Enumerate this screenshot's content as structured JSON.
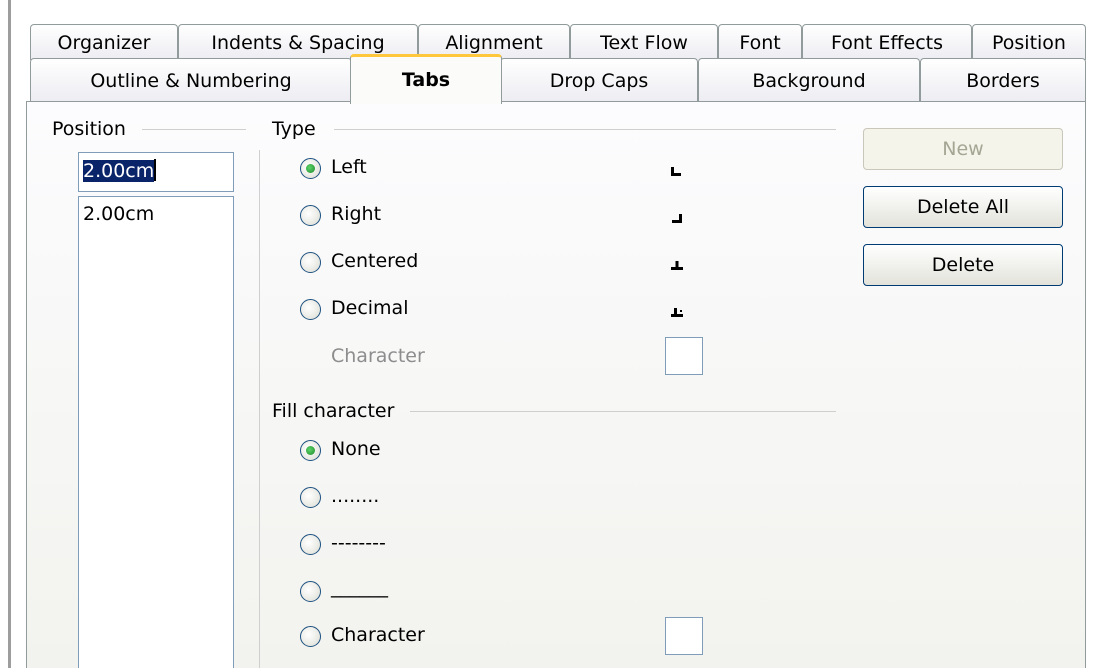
{
  "tabs": {
    "row1": [
      {
        "label": "Organizer"
      },
      {
        "label": "Indents & Spacing"
      },
      {
        "label": "Alignment"
      },
      {
        "label": "Text Flow"
      },
      {
        "label": "Font"
      },
      {
        "label": "Font Effects"
      },
      {
        "label": "Position"
      }
    ],
    "row2": [
      {
        "label": "Outline & Numbering"
      },
      {
        "label": "Tabs",
        "active": true
      },
      {
        "label": "Drop Caps"
      },
      {
        "label": "Background"
      },
      {
        "label": "Borders"
      }
    ]
  },
  "position": {
    "group_label": "Position",
    "input_value": "2.00cm",
    "list_items": [
      "2.00cm"
    ]
  },
  "type": {
    "group_label": "Type",
    "options": [
      {
        "label": "Left",
        "selected": true,
        "icon": "tab-left-icon"
      },
      {
        "label": "Right",
        "selected": false,
        "icon": "tab-right-icon"
      },
      {
        "label": "Centered",
        "selected": false,
        "icon": "tab-center-icon"
      },
      {
        "label": "Decimal",
        "selected": false,
        "icon": "tab-decimal-icon"
      }
    ],
    "character_label": "Character"
  },
  "fill": {
    "group_label": "Fill character",
    "options": [
      {
        "label": "None",
        "selected": true
      },
      {
        "label": "........",
        "selected": false
      },
      {
        "label": "--------",
        "selected": false
      },
      {
        "label": "______",
        "selected": false
      },
      {
        "label": "Character",
        "selected": false
      }
    ]
  },
  "buttons": {
    "new_label": "New",
    "delete_all_label": "Delete All",
    "delete_label": "Delete"
  },
  "colors": {
    "active_tab_accent": "#ffc83c",
    "radio_dot": "#1f8a2a",
    "selection": "#0a246a"
  }
}
